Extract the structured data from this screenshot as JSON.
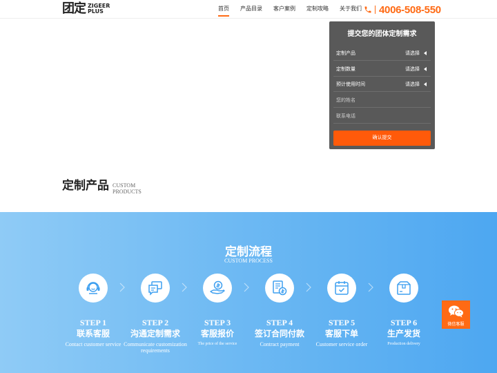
{
  "header": {
    "logo_cn": "团定",
    "logo_en_line1": "ZIGEER",
    "logo_en_line2": "PLUS",
    "nav": [
      {
        "label": "首页",
        "active": true
      },
      {
        "label": "产品目录",
        "active": false
      },
      {
        "label": "客户案例",
        "active": false
      },
      {
        "label": "定制攻略",
        "active": false
      },
      {
        "label": "关于我们",
        "active": false
      }
    ],
    "phone": "4006-508-550"
  },
  "form": {
    "title": "提交您的团体定制需求",
    "rows": [
      {
        "label": "定制产品",
        "select": "请选择"
      },
      {
        "label": "定制数量",
        "select": "请选择"
      },
      {
        "label": "预计使用时间",
        "select": "请选择"
      }
    ],
    "name_placeholder": "您的姓名",
    "phone_placeholder": "联系电话",
    "submit_label": "确认提交"
  },
  "products_section": {
    "title_cn": "定制产品",
    "title_en": "CUSTOM PRODUCTS"
  },
  "process": {
    "title": "定制流程",
    "subtitle": "CUSTOM PROCESS",
    "steps": [
      {
        "num": "STEP 1",
        "cn": "联系客服",
        "en": "Contact customer service",
        "icon": "headset-icon"
      },
      {
        "num": "STEP 2",
        "cn": "沟通定制需求",
        "en": "Communicate customization requirements",
        "icon": "chat-icon"
      },
      {
        "num": "STEP 3",
        "cn": "客服报价",
        "en": "The price of the service",
        "icon": "coin-hand-icon"
      },
      {
        "num": "STEP 4",
        "cn": "签订合同付款",
        "en": "Contract payment",
        "icon": "contract-icon"
      },
      {
        "num": "STEP 5",
        "cn": "客服下单",
        "en": "Customer service order",
        "icon": "calendar-icon"
      },
      {
        "num": "STEP 6",
        "cn": "生产发货",
        "en": "Production delivery",
        "icon": "box-icon"
      }
    ]
  },
  "wechat": {
    "label": "微信客服"
  },
  "colors": {
    "accent": "#ff6a14",
    "panel": "#595959",
    "process_gradient_start": "#8fcbf6",
    "process_gradient_end": "#4da7f1"
  }
}
